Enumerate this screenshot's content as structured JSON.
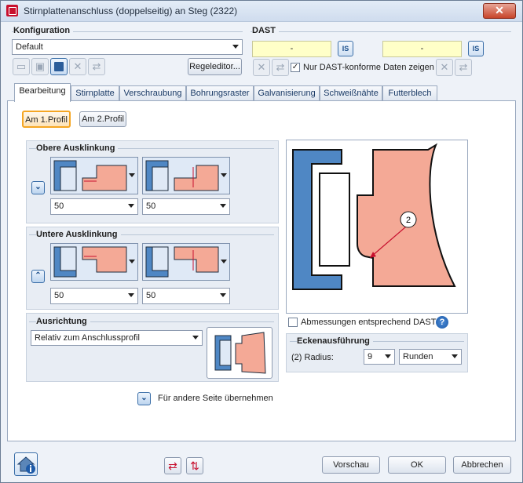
{
  "window": {
    "title": "Stirnplattenanschluss (doppelseitig) an Steg (2322)",
    "close_glyph": "✕"
  },
  "konfiguration": {
    "label": "Konfiguration",
    "selected": "Default",
    "regeleditor_label": "Regeleditor..."
  },
  "dast": {
    "label": "DAST",
    "field1": "-",
    "field2": "-",
    "is_label": "IS",
    "checkbox_label": "Nur DAST-konforme Daten zeigen",
    "checked": true
  },
  "tabs": [
    {
      "label": "Bearbeitung",
      "active": true
    },
    {
      "label": "Stirnplatte"
    },
    {
      "label": "Verschraubung"
    },
    {
      "label": "Bohrungsraster"
    },
    {
      "label": "Galvanisierung"
    },
    {
      "label": "Schweißnähte"
    },
    {
      "label": "Futterblech"
    }
  ],
  "profile_buttons": {
    "first": "Am 1.Profil",
    "second": "Am 2.Profil"
  },
  "obere": {
    "label": "Obere Ausklinkung",
    "value1": "50",
    "value2": "50"
  },
  "untere": {
    "label": "Untere Ausklinkung",
    "value1": "50",
    "value2": "50"
  },
  "ausrichtung": {
    "label": "Ausrichtung",
    "selected": "Relativ zum Anschlussprofil"
  },
  "preview": {
    "marker": "2"
  },
  "abmessungen": {
    "label": "Abmessungen entsprechend DAST",
    "checked": false,
    "help": "?"
  },
  "ecken": {
    "label": "Eckenausführung",
    "radius_label": "(2) Radius:",
    "radius_value": "9",
    "mode": "Runden"
  },
  "andere_seite": {
    "label": "Für andere Seite übernehmen"
  },
  "footer": {
    "vorschau": "Vorschau",
    "ok": "OK",
    "abbrechen": "Abbrechen"
  },
  "colors": {
    "steel_blue": "#4f87c4",
    "plate_salmon": "#f4a996",
    "accent_red": "#c8102e",
    "highlight_orange": "#f5a623"
  }
}
